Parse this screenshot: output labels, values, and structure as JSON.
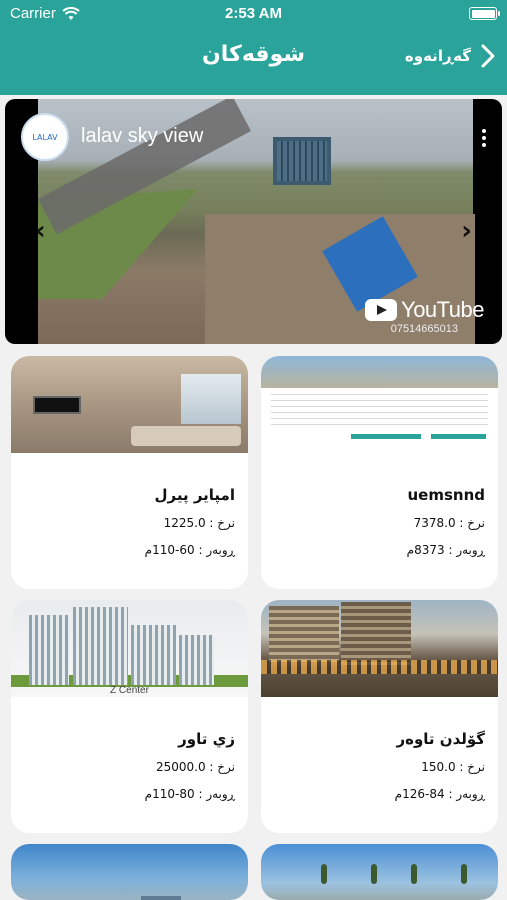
{
  "status_bar": {
    "carrier": "Carrier",
    "time": "2:53 AM"
  },
  "nav": {
    "title": "شوقەکان",
    "back_label": "گەڕانەوە"
  },
  "video": {
    "channel_title": "lalav sky view",
    "logo_text": "LALAV",
    "youtube_label": "YouTube",
    "phone": "07514665013"
  },
  "cards": [
    {
      "name": "امپایر پیرل",
      "price": "نرخ : 1225.0",
      "area": "ڕوبەر : 60-110م"
    },
    {
      "name": "uemsnnd",
      "price": "نرخ : 7378.0",
      "area": "ڕوبەر : 8373م"
    },
    {
      "name": "زي تاور",
      "price": "نرخ : 25000.0",
      "area": "ڕوبەر : 80-110م",
      "image_label": "Z Center"
    },
    {
      "name": "گۆلدن تاوەر",
      "price": "نرخ : 150.0",
      "area": "ڕوبەر : 84-126م"
    }
  ],
  "colors": {
    "accent": "#2aa39a",
    "background": "#f1f1f1",
    "card": "#ffffff"
  }
}
